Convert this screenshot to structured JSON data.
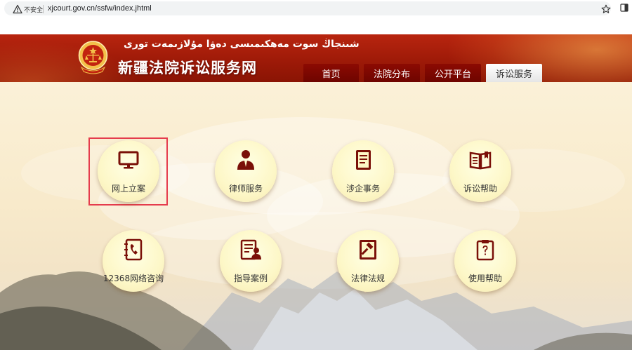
{
  "browser": {
    "security_label": "不安全",
    "url": "xjcourt.gov.cn/ssfw/index.jhtml"
  },
  "header": {
    "uyghur_title": "شىنجاڭ سوت مەھكىمىسى دەۋا مۇلازىمەت تورى",
    "title": "新疆法院诉讼服务网"
  },
  "nav": {
    "home": "首页",
    "courts": "法院分布",
    "public": "公开平台",
    "litigation": "诉讼服务"
  },
  "services": {
    "online_filing": "网上立案",
    "lawyer": "律师服务",
    "enterprise": "涉企事务",
    "help_litigation": "诉讼帮助",
    "hotline": "12368网络咨询",
    "cases": "指导案例",
    "laws": "法律法规",
    "usage_help": "使用帮助"
  },
  "colors": {
    "banner_red": "#a11c08",
    "icon_red": "#7a1008",
    "highlight": "#e53c4d"
  }
}
